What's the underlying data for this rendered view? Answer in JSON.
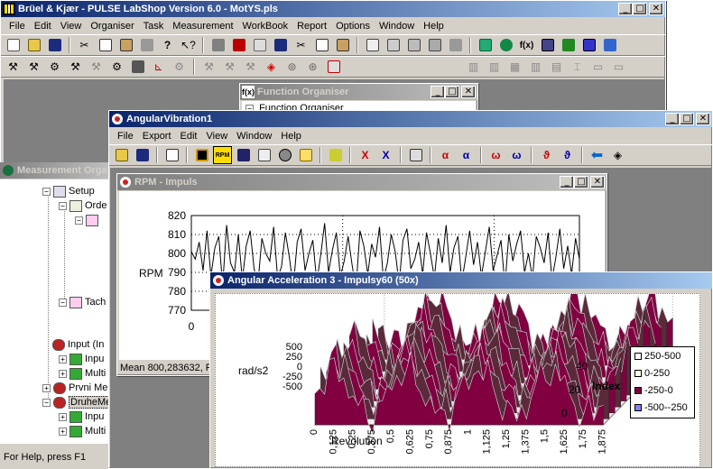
{
  "main": {
    "title": "Brüel & Kjær - PULSE LabShop Version 6.0 - MotYS.pls",
    "menu": [
      "File",
      "Edit",
      "View",
      "Organiser",
      "Task",
      "Measurement",
      "WorkBook",
      "Report",
      "Options",
      "Window",
      "Help"
    ]
  },
  "measurement_organiser": {
    "title": "Measurement Orga",
    "tree": [
      "Setup",
      "Orde",
      "Tach",
      "Input (In",
      "Inpu",
      "Multi",
      "Prvni Me",
      "DruheMe",
      "Inpu",
      "Multi"
    ]
  },
  "function_organiser": {
    "title": "Function Organiser",
    "item": "Function Organiser"
  },
  "angular_vibration": {
    "title": "AngularVibration1",
    "menu": [
      "File",
      "Export",
      "Edit",
      "View",
      "Window",
      "Help"
    ]
  },
  "rpm_window": {
    "title": "RPM - Impuls",
    "status": "Mean 800,283632,  R"
  },
  "accel_window": {
    "title": "Angular Acceleration 3 - Impulsy60  (50x)"
  },
  "statusbar": {
    "help": "For Help, press F1"
  },
  "chart_data": [
    {
      "type": "line",
      "title": "",
      "xlabel": "",
      "ylabel": "RPM",
      "y_ticks": [
        770,
        780,
        790,
        800,
        810,
        820
      ],
      "x_ticks": [
        0
      ],
      "ylim": [
        770,
        820
      ],
      "grid": "dotted",
      "series": [
        {
          "values": [
            801,
            797,
            806,
            791,
            812,
            788,
            803,
            809,
            783,
            815,
            795,
            790,
            810,
            786,
            804,
            812,
            792,
            784,
            808,
            800,
            796,
            814,
            787,
            793,
            811,
            798,
            782,
            806,
            813,
            791,
            800,
            807,
            785,
            799,
            816,
            790,
            802,
            811,
            788,
            796,
            809,
            794,
            781,
            812,
            804,
            789,
            805,
            798,
            814,
            786,
            795,
            810,
            801,
            784,
            807,
            813,
            792,
            797,
            806,
            789,
            811,
            800,
            787,
            808,
            795,
            815,
            790,
            803,
            809,
            785,
            798,
            812,
            794,
            806,
            788,
            801,
            814,
            791,
            799,
            807,
            783,
            810,
            796,
            805,
            812,
            790,
            800,
            787,
            809,
            803,
            795,
            811,
            786,
            798,
            813,
            792,
            804,
            789,
            808,
            797
          ]
        }
      ]
    },
    {
      "type": "surface",
      "title": "",
      "xlabel": "Revolution",
      "ylabel": "rad/s2",
      "zlabel": "Index",
      "x_ticks": [
        "0",
        "0,125",
        "0,25",
        "0,375",
        "0,5",
        "0,625",
        "0,75",
        "0,875",
        "1",
        "1,125",
        "1,25",
        "1,375",
        "1,5",
        "1,625",
        "1,75",
        "1,875"
      ],
      "y_ticks": [
        "500",
        "250",
        "0",
        "-250",
        "-500"
      ],
      "index_ticks": [
        "0",
        "20",
        "40"
      ],
      "ylim": [
        -500,
        500
      ],
      "legend": [
        {
          "label": "250-500",
          "color": "#ffffff"
        },
        {
          "label": "0-250",
          "color": "#ffffe0"
        },
        {
          "label": "-250-0",
          "color": "#800040"
        },
        {
          "label": "-500--250",
          "color": "#8080ff"
        }
      ],
      "legend_placement": "right"
    }
  ]
}
